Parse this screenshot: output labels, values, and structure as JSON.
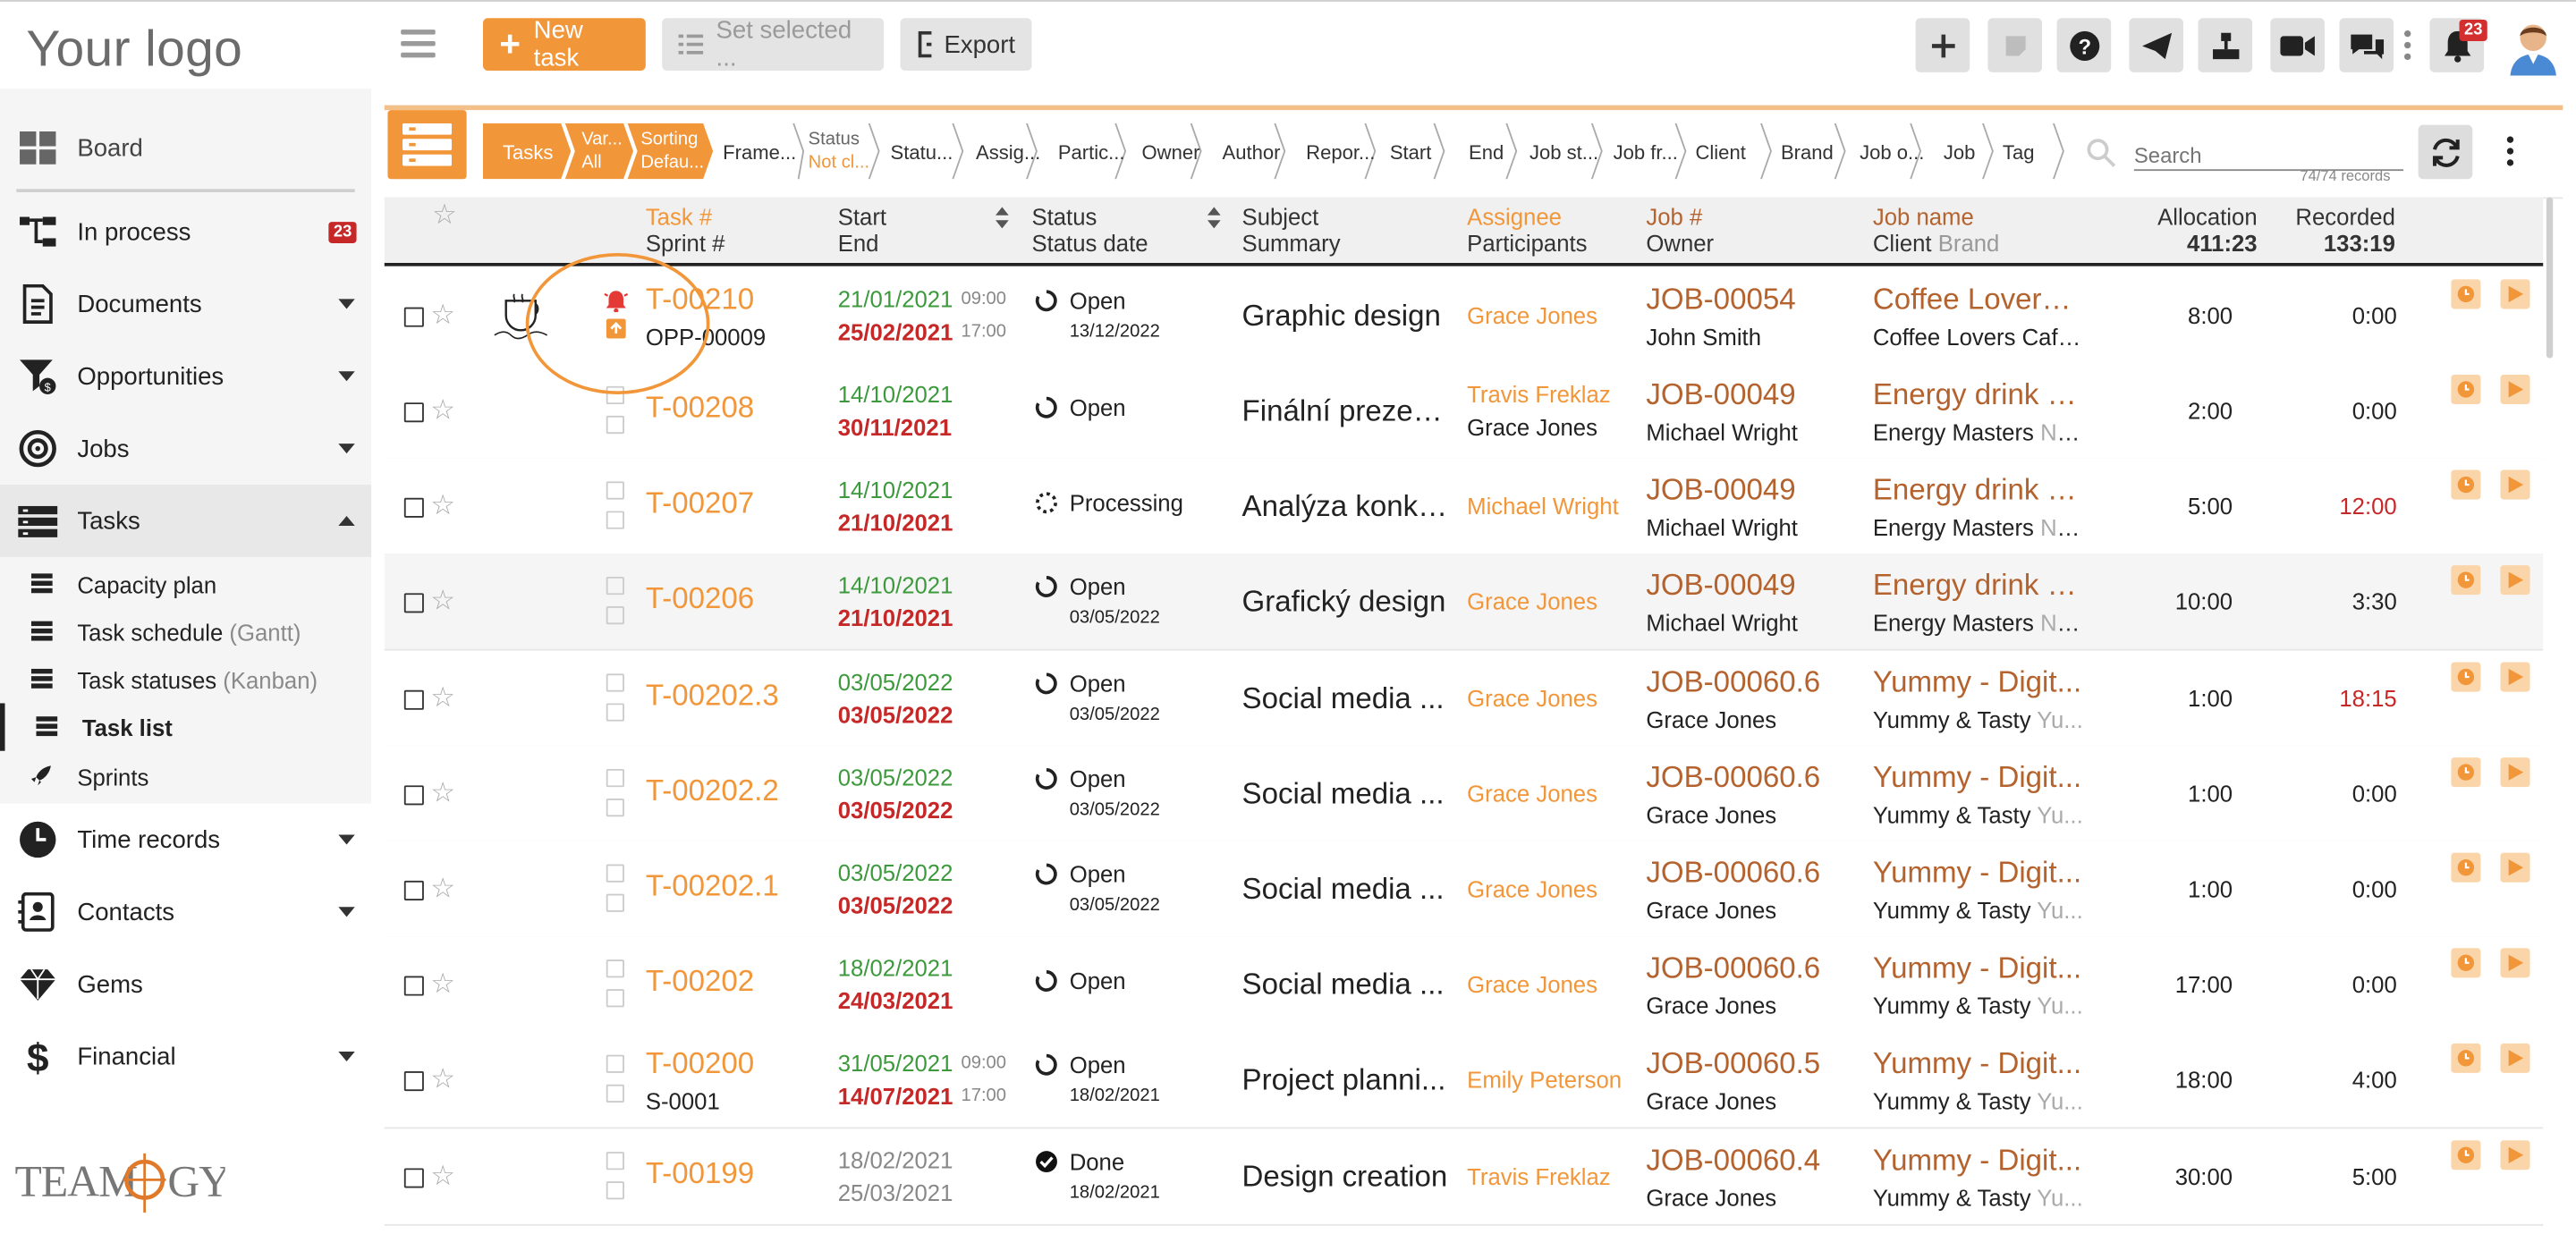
{
  "logo": "Your logo",
  "toolbar": {
    "new_task": "New task",
    "set_selected": "Set selected ...",
    "export": "Export",
    "notification_count": "23"
  },
  "sidebar": {
    "items": [
      {
        "label": "Board"
      },
      {
        "label": "In process",
        "count": "23"
      },
      {
        "label": "Documents"
      },
      {
        "label": "Opportunities"
      },
      {
        "label": "Jobs"
      },
      {
        "label": "Tasks"
      },
      {
        "label": "Time records"
      },
      {
        "label": "Contacts"
      },
      {
        "label": "Gems"
      },
      {
        "label": "Financial"
      }
    ],
    "sub": [
      {
        "label": "Capacity plan",
        "extra": ""
      },
      {
        "label": "Task schedule",
        "extra": "(Gantt)"
      },
      {
        "label": "Task statuses",
        "extra": "(Kanban)"
      },
      {
        "label": "Task list",
        "extra": ""
      },
      {
        "label": "Sprints",
        "extra": ""
      }
    ],
    "brand": "TEAMOGY"
  },
  "filters": {
    "tasks": "Tasks",
    "var_top": "Var...",
    "var_bottom": "All",
    "sort_top": "Sorting",
    "sort_bottom": "Defau...",
    "frame": "Frame...",
    "status_top": "Status",
    "status_bottom": "Not cl...",
    "items": [
      "Statu...",
      "Assig...",
      "Partic...",
      "Owner",
      "Author",
      "Repor...",
      "Start",
      "End",
      "Job st...",
      "Job fr...",
      "Client",
      "Brand",
      "Job o...",
      "Job",
      "Tag"
    ],
    "search_placeholder": "Search",
    "records": "74/74 records"
  },
  "header": {
    "task": "Task #",
    "sprint": "Sprint #",
    "start": "Start",
    "end": "End",
    "status": "Status",
    "status_date": "Status date",
    "subject": "Subject",
    "summary": "Summary",
    "assignee": "Assignee",
    "participants": "Participants",
    "job": "Job #",
    "owner": "Owner",
    "jobname": "Job name",
    "client": "Client",
    "brand": "Brand",
    "allocation": "Allocation",
    "allocation_total": "411:23",
    "recorded": "Recorded",
    "recorded_total": "133:19"
  },
  "rows": [
    {
      "task": "T-00210",
      "sprint": "OPP-00009",
      "start": "21/01/2021",
      "start_time": "09:00",
      "end": "25/02/2021",
      "end_time": "17:00",
      "status": "Open",
      "status_date": "13/12/2022",
      "subject": "Graphic design",
      "assignee": "Grace Jones",
      "participant": "",
      "job": "JOB-00054",
      "owner": "John Smith",
      "jobname": "Coffee Lovers ...",
      "client": "Coffee Lovers Café...",
      "brand": "",
      "alloc": "8:00",
      "rec": "0:00"
    },
    {
      "task": "T-00208",
      "sprint": "",
      "start": "14/10/2021",
      "start_time": "",
      "end": "30/11/2021",
      "end_time": "",
      "status": "Open",
      "status_date": "",
      "subject": "Finální prezen...",
      "assignee": "Travis Freklaz",
      "participant": "Grace Jones",
      "job": "JOB-00049",
      "owner": "Michael Wright",
      "jobname": "Energy drink - ...",
      "client": "Energy Masters",
      "brand": "Ne...",
      "alloc": "2:00",
      "rec": "0:00"
    },
    {
      "task": "T-00207",
      "sprint": "",
      "start": "14/10/2021",
      "start_time": "",
      "end": "21/10/2021",
      "end_time": "",
      "status": "Processing",
      "status_date": "",
      "subject": "Analýza konku...",
      "assignee": "Michael Wright",
      "participant": "",
      "job": "JOB-00049",
      "owner": "Michael Wright",
      "jobname": "Energy drink - ...",
      "client": "Energy Masters",
      "brand": "Ne...",
      "alloc": "5:00",
      "rec": "12:00"
    },
    {
      "task": "T-00206",
      "sprint": "",
      "start": "14/10/2021",
      "start_time": "",
      "end": "21/10/2021",
      "end_time": "",
      "status": "Open",
      "status_date": "03/05/2022",
      "subject": "Grafický design",
      "assignee": "Grace Jones",
      "participant": "",
      "job": "JOB-00049",
      "owner": "Michael Wright",
      "jobname": "Energy drink - ...",
      "client": "Energy Masters",
      "brand": "Ne...",
      "alloc": "10:00",
      "rec": "3:30"
    },
    {
      "task": "T-00202.3",
      "sprint": "",
      "start": "03/05/2022",
      "start_time": "",
      "end": "03/05/2022",
      "end_time": "",
      "status": "Open",
      "status_date": "03/05/2022",
      "subject": "Social media ...",
      "assignee": "Grace Jones",
      "participant": "",
      "job": "JOB-00060.6",
      "owner": "Grace Jones",
      "jobname": "Yummy - Digit...",
      "client": "Yummy & Tasty",
      "brand": "Yu...",
      "alloc": "1:00",
      "rec": "18:15"
    },
    {
      "task": "T-00202.2",
      "sprint": "",
      "start": "03/05/2022",
      "start_time": "",
      "end": "03/05/2022",
      "end_time": "",
      "status": "Open",
      "status_date": "03/05/2022",
      "subject": "Social media ...",
      "assignee": "Grace Jones",
      "participant": "",
      "job": "JOB-00060.6",
      "owner": "Grace Jones",
      "jobname": "Yummy - Digit...",
      "client": "Yummy & Tasty",
      "brand": "Yu...",
      "alloc": "1:00",
      "rec": "0:00"
    },
    {
      "task": "T-00202.1",
      "sprint": "",
      "start": "03/05/2022",
      "start_time": "",
      "end": "03/05/2022",
      "end_time": "",
      "status": "Open",
      "status_date": "03/05/2022",
      "subject": "Social media ...",
      "assignee": "Grace Jones",
      "participant": "",
      "job": "JOB-00060.6",
      "owner": "Grace Jones",
      "jobname": "Yummy - Digit...",
      "client": "Yummy & Tasty",
      "brand": "Yu...",
      "alloc": "1:00",
      "rec": "0:00"
    },
    {
      "task": "T-00202",
      "sprint": "",
      "start": "18/02/2021",
      "start_time": "",
      "end": "24/03/2021",
      "end_time": "",
      "status": "Open",
      "status_date": "",
      "subject": "Social media ...",
      "assignee": "Grace Jones",
      "participant": "",
      "job": "JOB-00060.6",
      "owner": "Grace Jones",
      "jobname": "Yummy - Digit...",
      "client": "Yummy & Tasty",
      "brand": "Yu...",
      "alloc": "17:00",
      "rec": "0:00"
    },
    {
      "task": "T-00200",
      "sprint": "S-0001",
      "start": "31/05/2021",
      "start_time": "09:00",
      "end": "14/07/2021",
      "end_time": "17:00",
      "status": "Open",
      "status_date": "18/02/2021",
      "subject": "Project planni...",
      "assignee": "Emily Peterson",
      "participant": "",
      "job": "JOB-00060.5",
      "owner": "Grace Jones",
      "jobname": "Yummy - Digit...",
      "client": "Yummy & Tasty",
      "brand": "Yu...",
      "alloc": "18:00",
      "rec": "4:00"
    },
    {
      "task": "T-00199",
      "sprint": "",
      "start": "18/02/2021",
      "start_time": "",
      "end": "25/03/2021",
      "end_time": "",
      "status": "Done",
      "status_date": "18/02/2021",
      "subject": "Design creation",
      "assignee": "Travis Freklaz",
      "participant": "",
      "job": "JOB-00060.4",
      "owner": "Grace Jones",
      "jobname": "Yummy - Digit...",
      "client": "Yummy & Tasty",
      "brand": "Yu...",
      "alloc": "30:00",
      "rec": "5:00"
    }
  ],
  "colors": {
    "accent": "#f2963a",
    "job": "#b4622e",
    "overdue": "#c62828",
    "start": "#3c9a3c"
  }
}
